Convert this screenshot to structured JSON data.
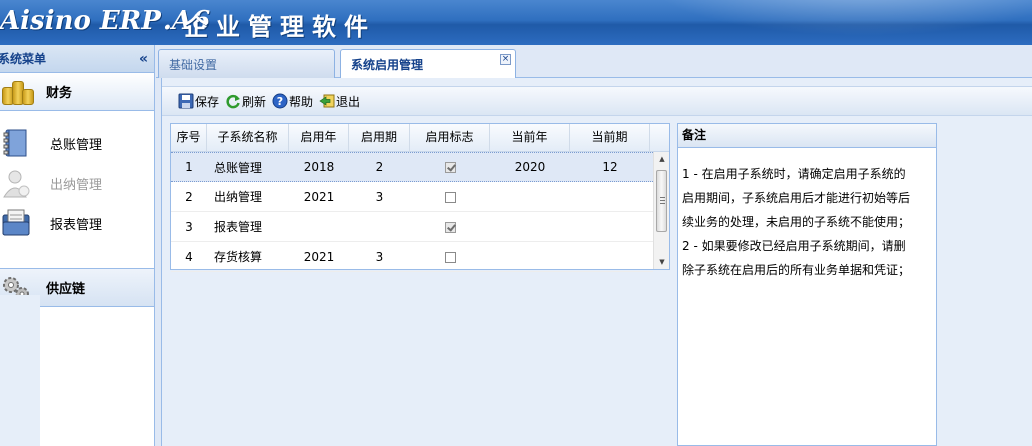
{
  "app": {
    "logo_main": "Aisino ERP",
    "logo_sub": ".A6",
    "title": "企业管理软件"
  },
  "sidebar": {
    "title": "系统菜单",
    "collapse_symbol": "«",
    "groups": [
      {
        "label": "财务",
        "icon": "coins-icon"
      },
      {
        "label": "供应链",
        "icon": "gears-icon"
      }
    ],
    "items": [
      {
        "label": "总账管理",
        "icon": "ledger-book-icon",
        "enabled": true
      },
      {
        "label": "出纳管理",
        "icon": "person-icon",
        "enabled": false
      },
      {
        "label": "报表管理",
        "icon": "folder-report-icon",
        "enabled": true
      }
    ]
  },
  "tabs": [
    {
      "label": "基础设置",
      "active": false
    },
    {
      "label": "系统启用管理",
      "active": true,
      "close_symbol": "×"
    }
  ],
  "toolbar": {
    "save": "保存",
    "refresh": "刷新",
    "help": "帮助",
    "exit": "退出"
  },
  "grid": {
    "columns": [
      "序号",
      "子系统名称",
      "启用年",
      "启用期",
      "启用标志",
      "当前年",
      "当前期"
    ],
    "rows": [
      {
        "no": "1",
        "name": "总账管理",
        "year": "2018",
        "period": "2",
        "enabled": true,
        "cur_year": "2020",
        "cur_period": "12",
        "selected": true
      },
      {
        "no": "2",
        "name": "出纳管理",
        "year": "2021",
        "period": "3",
        "enabled": false,
        "cur_year": "",
        "cur_period": "",
        "selected": false
      },
      {
        "no": "3",
        "name": "报表管理",
        "year": "",
        "period": "",
        "enabled": true,
        "cur_year": "",
        "cur_period": "",
        "selected": false
      },
      {
        "no": "4",
        "name": "存货核算",
        "year": "2021",
        "period": "3",
        "enabled": false,
        "cur_year": "",
        "cur_period": "",
        "selected": false
      }
    ]
  },
  "notes": {
    "title": "备注",
    "lines": [
      "1 - 在启用子系统时，请确定启用子系统的",
      "启用期间，子系统启用后才能进行初始等后",
      "续业务的处理，未启用的子系统不能使用；",
      "2 - 如果要修改已经启用子系统期间，请删",
      "除子系统在启用后的所有业务单据和凭证；"
    ]
  },
  "colors": {
    "header_blue": "#2f6fbf",
    "panel_border": "#99bbe8",
    "tab_text": "#15428b"
  }
}
